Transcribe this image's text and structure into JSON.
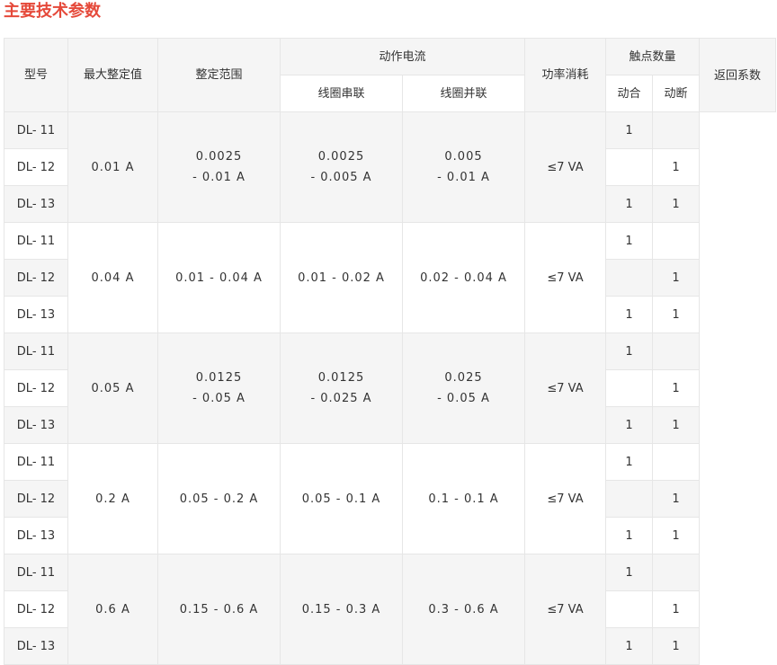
{
  "title": "主要技术参数",
  "headers": {
    "model": "型号",
    "max_setting": "最大整定值",
    "setting_range": "整定范围",
    "operating_current": "动作电流",
    "coil_series": "线圈串联",
    "coil_parallel": "线圈并联",
    "power": "功率消耗",
    "contacts": "触点数量",
    "make": "动合",
    "break": "动断",
    "return_coeff": "返回系数"
  },
  "groups": [
    {
      "max": "0.01 A",
      "range": [
        "0.0025",
        "- 0.01 A"
      ],
      "series": [
        "0.0025",
        "- 0.005 A"
      ],
      "parallel": [
        "0.005",
        "- 0.01 A"
      ],
      "power": "≤7 VA",
      "rows": [
        {
          "model": "DL- 11",
          "make": "1",
          "break": ""
        },
        {
          "model": "DL- 12",
          "make": "",
          "break": "1"
        },
        {
          "model": "DL- 13",
          "make": "1",
          "break": "1"
        }
      ]
    },
    {
      "max": "0.04 A",
      "range": [
        "0.01 - 0.04 A"
      ],
      "series": [
        "0.01 - 0.02 A"
      ],
      "parallel": [
        "0.02 - 0.04 A"
      ],
      "power": "≤7 VA",
      "rows": [
        {
          "model": "DL- 11",
          "make": "1",
          "break": ""
        },
        {
          "model": "DL- 12",
          "make": "",
          "break": "1"
        },
        {
          "model": "DL- 13",
          "make": "1",
          "break": "1"
        }
      ]
    },
    {
      "max": "0.05 A",
      "range": [
        "0.0125",
        "- 0.05 A"
      ],
      "series": [
        "0.0125",
        "- 0.025 A"
      ],
      "parallel": [
        "0.025",
        "- 0.05 A"
      ],
      "power": "≤7 VA",
      "rows": [
        {
          "model": "DL- 11",
          "make": "1",
          "break": ""
        },
        {
          "model": "DL- 12",
          "make": "",
          "break": "1"
        },
        {
          "model": "DL- 13",
          "make": "1",
          "break": "1"
        }
      ]
    },
    {
      "max": "0.2 A",
      "range": [
        "0.05 - 0.2 A"
      ],
      "series": [
        "0.05 - 0.1 A"
      ],
      "parallel": [
        "0.1 - 0.1 A"
      ],
      "power": "≤7 VA",
      "rows": [
        {
          "model": "DL- 11",
          "make": "1",
          "break": ""
        },
        {
          "model": "DL- 12",
          "make": "",
          "break": "1"
        },
        {
          "model": "DL- 13",
          "make": "1",
          "break": "1"
        }
      ]
    },
    {
      "max": "0.6 A",
      "range": [
        "0.15 - 0.6 A"
      ],
      "series": [
        "0.15 - 0.3 A"
      ],
      "parallel": [
        "0.3 - 0.6 A"
      ],
      "power": "≤7 VA",
      "rows": [
        {
          "model": "DL- 11",
          "make": "1",
          "break": ""
        },
        {
          "model": "DL- 12",
          "make": "",
          "break": "1"
        },
        {
          "model": "DL- 13",
          "make": "1",
          "break": "1"
        }
      ]
    }
  ],
  "colors": {
    "title": "#e5493a",
    "header_bg": "#f5f5f5",
    "border": "#e6e6e6",
    "text": "#333333"
  }
}
